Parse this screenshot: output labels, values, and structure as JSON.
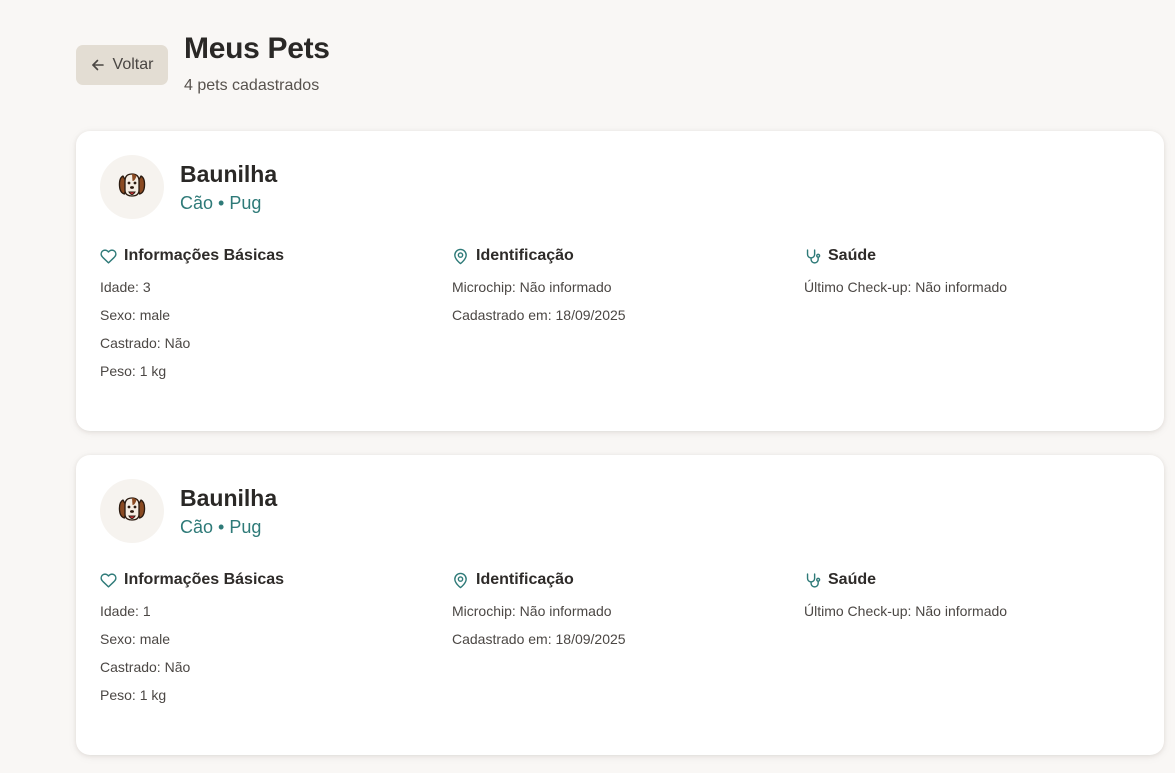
{
  "header": {
    "back_label": "Voltar",
    "title": "Meus Pets",
    "subtitle": "4 pets cadastrados"
  },
  "colors": {
    "background": "#f9f7f5",
    "accent": "#2e7a78",
    "back_button": "#e3ddd3",
    "card": "#ffffff"
  },
  "icons": {
    "back": "arrow-left-icon",
    "avatar": "dog-icon",
    "basic": "heart-icon",
    "identification": "map-pin-icon",
    "health": "stethoscope-icon"
  },
  "pets": [
    {
      "name": "Baunilha",
      "species_breed": "Cão • Pug",
      "basic_title": "Informações Básicas",
      "basic_rows": [
        "Idade: 3",
        "Sexo: male",
        "Castrado: Não",
        "Peso: 1 kg"
      ],
      "id_title": "Identificação",
      "id_rows": [
        "Microchip: Não informado",
        "Cadastrado em: 18/09/2025"
      ],
      "health_title": "Saúde",
      "health_rows": [
        "Último Check-up: Não informado"
      ]
    },
    {
      "name": "Baunilha",
      "species_breed": "Cão • Pug",
      "basic_title": "Informações Básicas",
      "basic_rows": [
        "Idade: 1",
        "Sexo: male",
        "Castrado: Não",
        "Peso: 1 kg"
      ],
      "id_title": "Identificação",
      "id_rows": [
        "Microchip: Não informado",
        "Cadastrado em: 18/09/2025"
      ],
      "health_title": "Saúde",
      "health_rows": [
        "Último Check-up: Não informado"
      ]
    }
  ]
}
